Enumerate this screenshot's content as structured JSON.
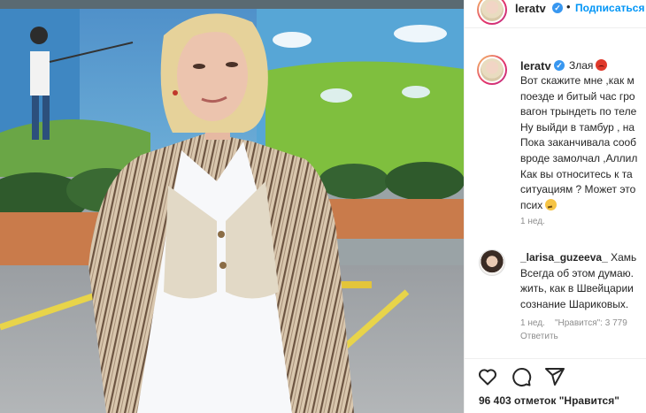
{
  "header": {
    "username": "leratv",
    "separator": "•",
    "follow_label": "Подписаться",
    "verified_badge": "✓"
  },
  "post": {
    "username": "leratv",
    "mood_text": "Злая",
    "mood_emoji": "angry-face",
    "caption_lines": [
      "Вот скажите мне ,как м",
      "поезде и битый час гро",
      "вагон трындеть по теле",
      "Ну выйди в тамбур , на",
      "Пока заканчивала сооб",
      "вроде замолчал ,Аллил",
      "Как вы относитесь к та",
      "ситуациям ? Может это",
      "псих"
    ],
    "caption_end_emoji": "thinking-face",
    "time": "1 нед."
  },
  "comment": {
    "username": "_larisa_guzeeva_",
    "lines": [
      "Хамь",
      "Всегда об этом думаю.",
      "жить, как в Швейцарии",
      "сознание Шариковых."
    ],
    "time": "1 нед.",
    "likes": "\"Нравится\": 3 779",
    "reply_label": "Ответить"
  },
  "actions": {
    "like_icon": "heart-icon",
    "comment_icon": "comment-icon",
    "share_icon": "share-icon",
    "likes_text": "96 403 отметок \"Нравится\""
  },
  "colors": {
    "link_blue": "#0095f6",
    "verified_blue": "#3897f0",
    "muted_grey": "#8e8e8e",
    "text": "#262626"
  }
}
